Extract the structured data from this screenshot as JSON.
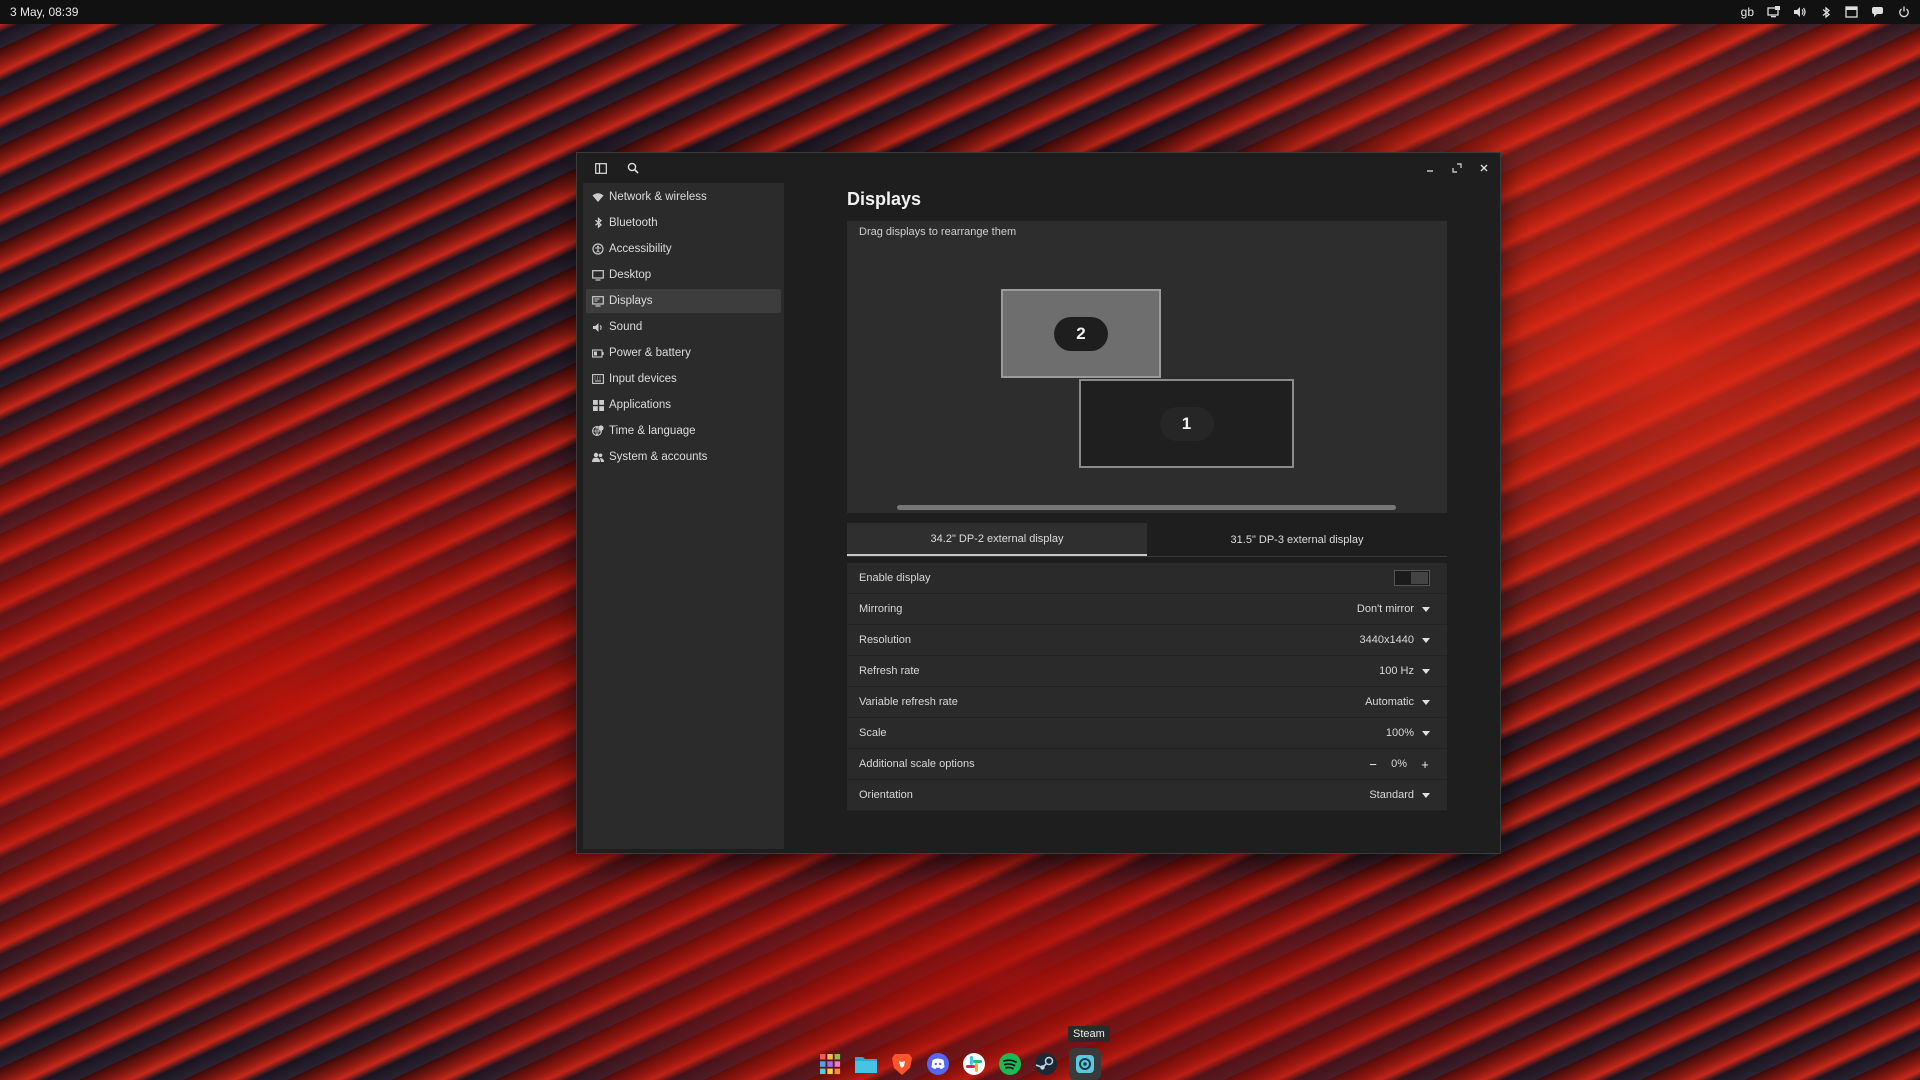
{
  "topbar": {
    "datetime": "3 May, 08:39",
    "keyboard_layout": "gb",
    "tray_icons": [
      "screen-icon",
      "volume-icon",
      "bluetooth-icon",
      "window-icon",
      "chat-icon",
      "power-icon"
    ]
  },
  "window": {
    "title": "Displays",
    "sidebar": {
      "items": [
        {
          "label": "Network & wireless",
          "icon": "wifi-icon"
        },
        {
          "label": "Bluetooth",
          "icon": "bluetooth-icon"
        },
        {
          "label": "Accessibility",
          "icon": "accessibility-icon"
        },
        {
          "label": "Desktop",
          "icon": "desktop-icon"
        },
        {
          "label": "Displays",
          "icon": "display-icon",
          "active": true
        },
        {
          "label": "Sound",
          "icon": "speaker-icon"
        },
        {
          "label": "Power & battery",
          "icon": "battery-icon"
        },
        {
          "label": "Input devices",
          "icon": "keyboard-icon"
        },
        {
          "label": "Applications",
          "icon": "apps-grid-icon"
        },
        {
          "label": "Time & language",
          "icon": "globe-clock-icon"
        },
        {
          "label": "System & accounts",
          "icon": "users-icon"
        }
      ]
    },
    "arrange": {
      "hint": "Drag displays to rearrange them",
      "monitors": [
        {
          "number": "2",
          "active": true
        },
        {
          "number": "1",
          "active": false
        }
      ]
    },
    "tabs": [
      {
        "label": "34.2\" DP-2 external display",
        "active": true
      },
      {
        "label": "31.5\" DP-3 external display",
        "active": false
      }
    ],
    "settings": {
      "enable_display": {
        "label": "Enable display",
        "enabled": false
      },
      "mirroring": {
        "label": "Mirroring",
        "value": "Don't mirror"
      },
      "resolution": {
        "label": "Resolution",
        "value": "3440x1440"
      },
      "refresh_rate": {
        "label": "Refresh rate",
        "value": "100 Hz"
      },
      "variable_refresh_rate": {
        "label": "Variable refresh rate",
        "value": "Automatic"
      },
      "scale": {
        "label": "Scale",
        "value": "100%"
      },
      "additional_scale": {
        "label": "Additional scale options",
        "value": "0%",
        "minus": "−",
        "plus": "+"
      },
      "orientation": {
        "label": "Orientation",
        "value": "Standard"
      }
    }
  },
  "dock": {
    "tooltip": "Steam",
    "apps": [
      "app-grid",
      "files",
      "brave",
      "discord",
      "slack",
      "spotify",
      "steam",
      "settings"
    ]
  },
  "colors": {
    "accent": "#c8c8c8",
    "window_bg": "#1e1e1e",
    "sidebar_bg": "#2b2b2b",
    "spotify_green": "#1db954",
    "discord_blurple": "#5865f2",
    "brave_orange": "#fb542b"
  }
}
